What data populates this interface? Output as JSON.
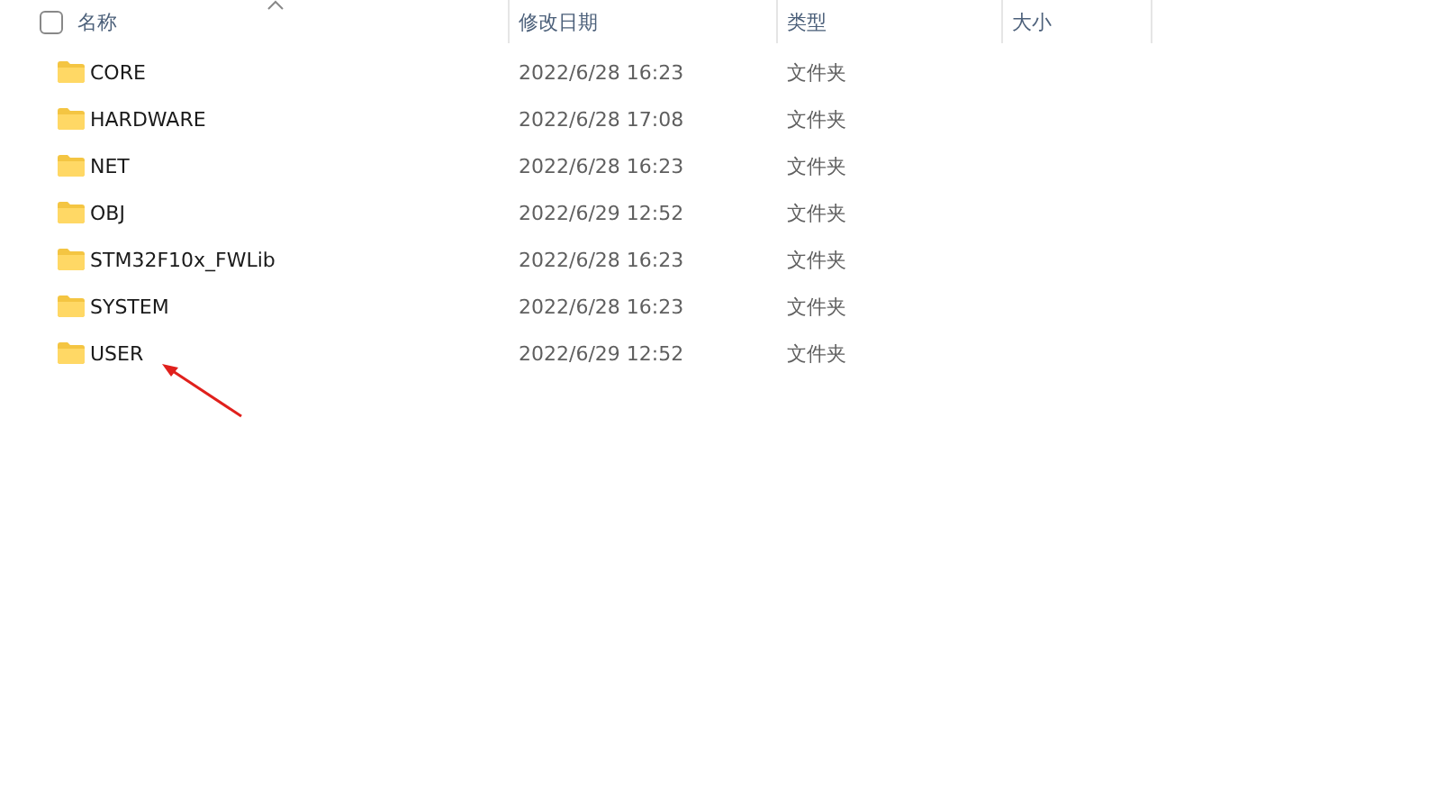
{
  "header": {
    "select_all": {
      "checked": false
    },
    "columns": [
      "名称",
      "修改日期",
      "类型",
      "大小"
    ]
  },
  "rows": [
    {
      "name": "CORE",
      "modified": "2022/6/28 16:23",
      "type": "文件夹"
    },
    {
      "name": "HARDWARE",
      "modified": "2022/6/28 17:08",
      "type": "文件夹"
    },
    {
      "name": "NET",
      "modified": "2022/6/28 16:23",
      "type": "文件夹"
    },
    {
      "name": "OBJ",
      "modified": "2022/6/29 12:52",
      "type": "文件夹"
    },
    {
      "name": "STM32F10x_FWLib",
      "modified": "2022/6/28 16:23",
      "type": "文件夹"
    },
    {
      "name": "SYSTEM",
      "modified": "2022/6/28 16:23",
      "type": "文件夹"
    },
    {
      "name": "USER",
      "modified": "2022/6/29 12:52",
      "type": "文件夹"
    }
  ]
}
